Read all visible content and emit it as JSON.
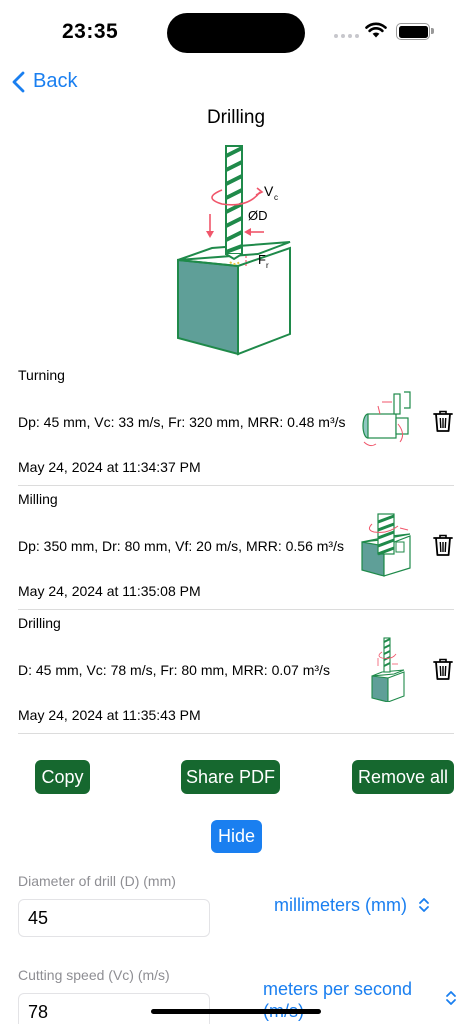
{
  "status_bar": {
    "time": "23:35"
  },
  "nav": {
    "back_label": "Back"
  },
  "page": {
    "title": "Drilling"
  },
  "diagram_labels": {
    "vc": "V",
    "vc_sub": "c",
    "diameter": "ØD",
    "fr": "F",
    "fr_sub": "r"
  },
  "history": [
    {
      "title": "Turning",
      "description": "Dp: 45 mm,  Vc: 33 m/s, Fr: 320 mm, MRR: 0.48 m³/s",
      "date": "May 24, 2024 at 11:34:37 PM",
      "icon": "turning-icon"
    },
    {
      "title": "Milling",
      "description": "Dp: 350 mm,  Dr: 80 mm, Vf: 20 m/s, MRR: 0.56 m³/s",
      "date": "May 24, 2024 at 11:35:08 PM",
      "icon": "milling-icon"
    },
    {
      "title": "Drilling",
      "description": "D: 45 mm,  Vc: 78 m/s, Fr: 80 mm, MRR: 0.07 m³/s",
      "date": "May 24, 2024 at 11:35:43 PM",
      "icon": "drilling-icon"
    }
  ],
  "actions": {
    "copy": "Copy",
    "share_pdf": "Share PDF",
    "remove_all": "Remove all",
    "hide": "Hide"
  },
  "form": {
    "diameter": {
      "label": "Diameter of drill (D) (mm)",
      "value": "45",
      "unit": "millimeters (mm)"
    },
    "cutting_speed": {
      "label": "Cutting speed (Vc) (m/s)",
      "value": "78",
      "unit_line1": "meters per second",
      "unit_line2": "(m/s)"
    }
  },
  "colors": {
    "accent": "#1a7ff0",
    "button_green": "#16682f",
    "drill_green": "#1f8a4a",
    "block_fill": "#5f9f98"
  }
}
